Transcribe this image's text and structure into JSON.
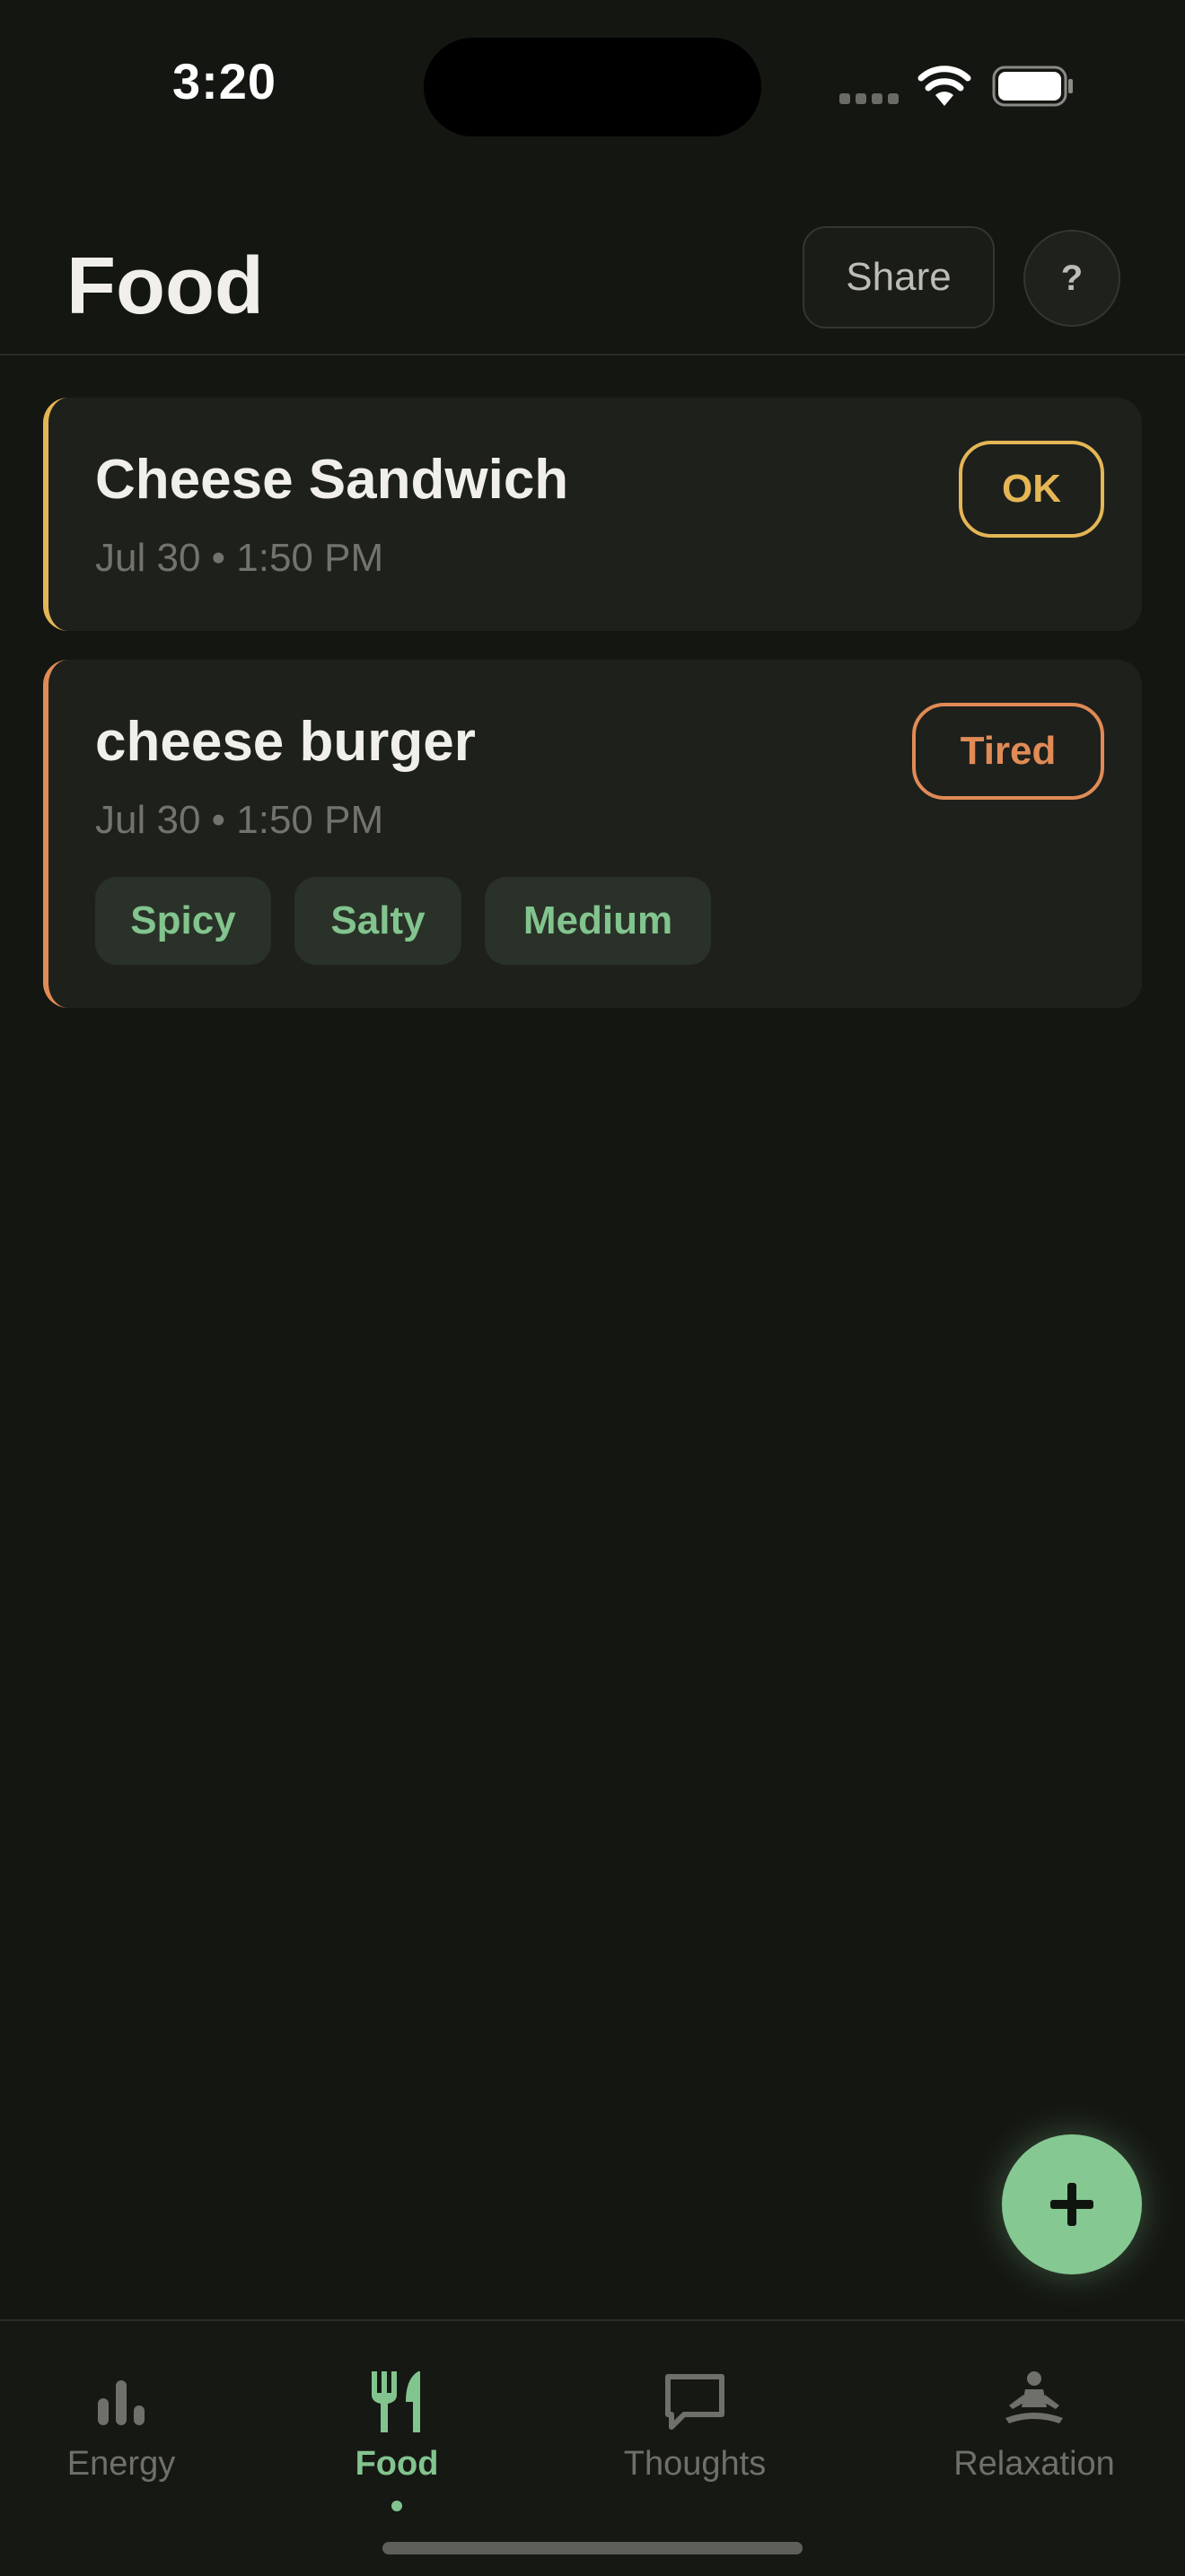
{
  "status_bar": {
    "time": "3:20"
  },
  "header": {
    "title": "Food",
    "share_label": "Share",
    "help_label": "?"
  },
  "entries": [
    {
      "title": "Cheese Sandwich",
      "time": "Jul 30 • 1:50 PM",
      "status": "OK",
      "status_color": "#e4b654",
      "tags": []
    },
    {
      "title": "cheese burger",
      "time": "Jul 30 • 1:50 PM",
      "status": "Tired",
      "status_color": "#e08b56",
      "tags": [
        "Spicy",
        "Salty",
        "Medium"
      ]
    }
  ],
  "fab": {
    "icon": "plus-icon"
  },
  "tabs": [
    {
      "label": "Energy",
      "icon": "bar-chart-icon",
      "active": false
    },
    {
      "label": "Food",
      "icon": "fork-knife-icon",
      "active": true
    },
    {
      "label": "Thoughts",
      "icon": "speech-bubble-icon",
      "active": false
    },
    {
      "label": "Relaxation",
      "icon": "meditation-icon",
      "active": false
    }
  ],
  "colors": {
    "background": "#141612",
    "accent": "#82c48e",
    "ok": "#e4b654",
    "tired": "#e08b56"
  }
}
